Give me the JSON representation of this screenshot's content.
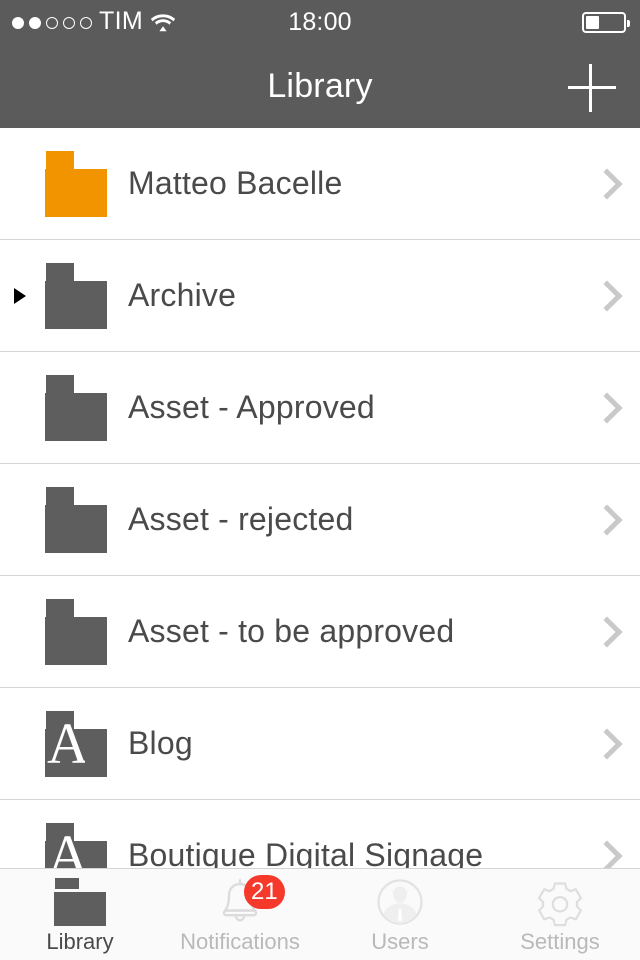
{
  "status_bar": {
    "carrier": "TIM",
    "time": "18:00",
    "signal_dots_total": 5,
    "signal_dots_filled": 2,
    "wifi_icon": "wifi-icon",
    "battery_icon": "battery-icon",
    "battery_level_percent": 32
  },
  "nav_bar": {
    "title": "Library",
    "add_icon": "plus-icon",
    "background_color": "#5b5b5b"
  },
  "colors": {
    "header_gray": "#5b5b5b",
    "folder_gray": "#5e5e5e",
    "folder_orange": "#f29400",
    "badge_red": "#f5392b",
    "chevron_gray": "#c9c9c9",
    "text_gray": "#4a4a4a",
    "separator": "#d4d4d4"
  },
  "list": {
    "rows": [
      {
        "label": "Matteo Bacelle",
        "folder_color": "orange",
        "expandable": false,
        "glyph": ""
      },
      {
        "label": "Archive",
        "folder_color": "gray",
        "expandable": true,
        "glyph": ""
      },
      {
        "label": "Asset - Approved",
        "folder_color": "gray",
        "expandable": false,
        "glyph": ""
      },
      {
        "label": "Asset - rejected",
        "folder_color": "gray",
        "expandable": false,
        "glyph": ""
      },
      {
        "label": "Asset - to be approved",
        "folder_color": "gray",
        "expandable": false,
        "glyph": ""
      },
      {
        "label": "Blog",
        "folder_color": "gray",
        "expandable": false,
        "glyph": "A"
      },
      {
        "label": "Boutique Digital Signage",
        "folder_color": "gray",
        "expandable": false,
        "glyph": "A"
      }
    ]
  },
  "tab_bar": {
    "tabs": [
      {
        "label": "Library",
        "icon": "folder-icon",
        "active": true,
        "badge": ""
      },
      {
        "label": "Notifications",
        "icon": "bell-icon",
        "active": false,
        "badge": "21"
      },
      {
        "label": "Users",
        "icon": "user-circle-icon",
        "active": false,
        "badge": ""
      },
      {
        "label": "Settings",
        "icon": "gear-icon",
        "active": false,
        "badge": ""
      }
    ]
  }
}
